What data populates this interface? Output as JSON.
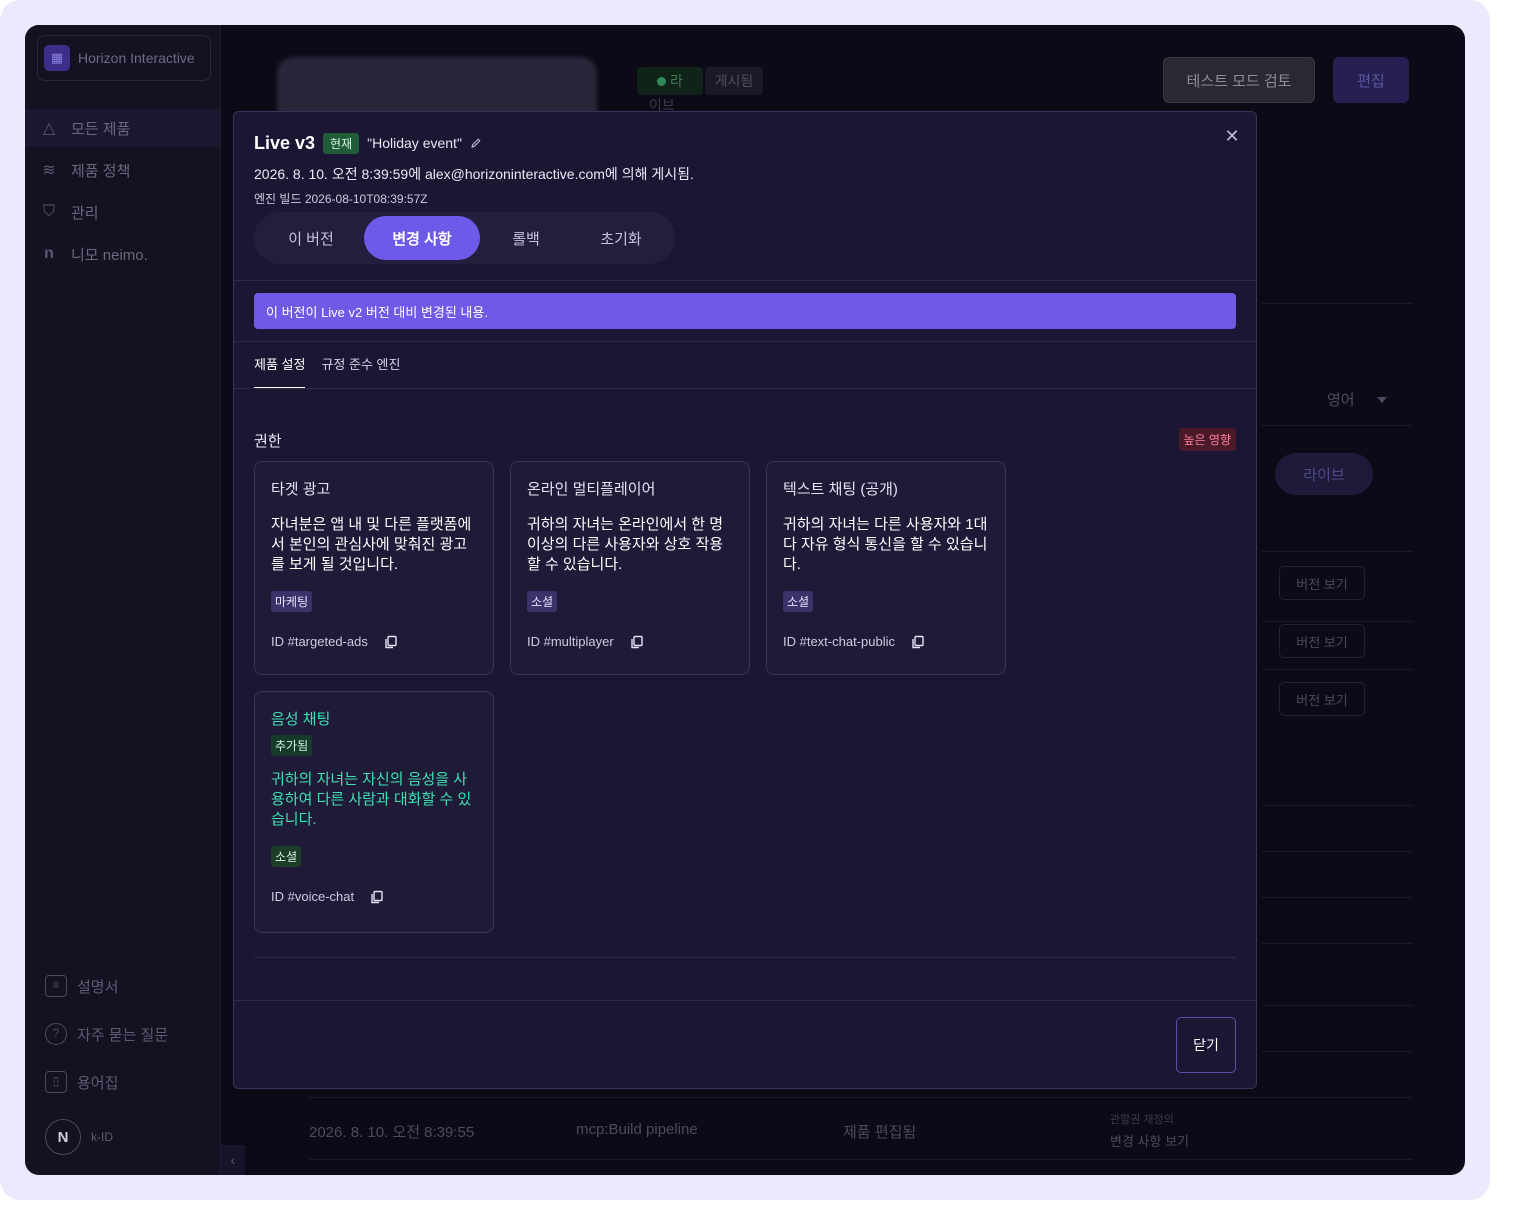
{
  "background": {
    "org_name": "Horizon Interactive",
    "nav": [
      "모든 제품",
      "제품 정책",
      "관리",
      "니모 neimo."
    ],
    "bottom_nav": [
      "설명서",
      "자주 묻는 질문",
      "용어집"
    ],
    "brand": "k-ID",
    "live_badge": "라",
    "live_badge_sub": "이브",
    "posted_badge": "게시됨",
    "test_mode_button": "테스트 모드 검토",
    "edit_button": "편집",
    "language": "영어",
    "live_pill": "라이브",
    "version_view": "버전 보기",
    "last_row": {
      "date": "2026. 8. 10. 오전 8:39:55",
      "actor": "mcp:Build pipeline",
      "action": "제품 편집됨",
      "note_small": "관할권 재정의",
      "note_link": "변경 사항 보기"
    }
  },
  "modal": {
    "title": "Live v3",
    "current_badge": "현재",
    "version_name": "\"Holiday event\"",
    "published": "2026. 8. 10. 오전 8:39:59에 alex@horizoninteractive.com에 의해 게시됨.",
    "build": "엔진 빌드 2026-08-10T08:39:57Z",
    "segments": [
      "이 버전",
      "변경 사항",
      "롤백",
      "초기화"
    ],
    "active_segment": 1,
    "banner": "이 버전이 Live v2 버전 대비 변경된 내용.",
    "subtabs": [
      "제품 설정",
      "규정 준수 엔진"
    ],
    "section_title": "권한",
    "impact_badge": "높은 영향",
    "cards": [
      {
        "title": "타겟 광고",
        "desc": "자녀분은 앱 내 및 다른 플랫폼에서 본인의 관심사에 맞춰진 광고를 보게 될 것입니다.",
        "tag": "마케팅",
        "id": "ID #targeted-ads"
      },
      {
        "title": "온라인 멀티플레이어",
        "desc": "귀하의 자녀는 온라인에서 한 명 이상의 다른 사용자와 상호 작용할 수 있습니다.",
        "tag": "소셜",
        "id": "ID #multiplayer"
      },
      {
        "title": "텍스트 채팅 (공개)",
        "desc": "귀하의 자녀는 다른 사용자와 1대 다 자유 형식 통신을 할 수 있습니다.",
        "tag": "소셜",
        "id": "ID #text-chat-public"
      },
      {
        "title": "음성 채팅",
        "added": "추가됨",
        "desc": "귀하의 자녀는 자신의 음성을 사용하여 다른 사람과 대화할 수 있습니다.",
        "tag": "소셜",
        "id": "ID #voice-chat"
      }
    ],
    "close_button": "닫기"
  },
  "colors": {
    "accent": "#6e5ae8",
    "added_text": "#3ee0b0",
    "impact": "#ff7f9b"
  }
}
